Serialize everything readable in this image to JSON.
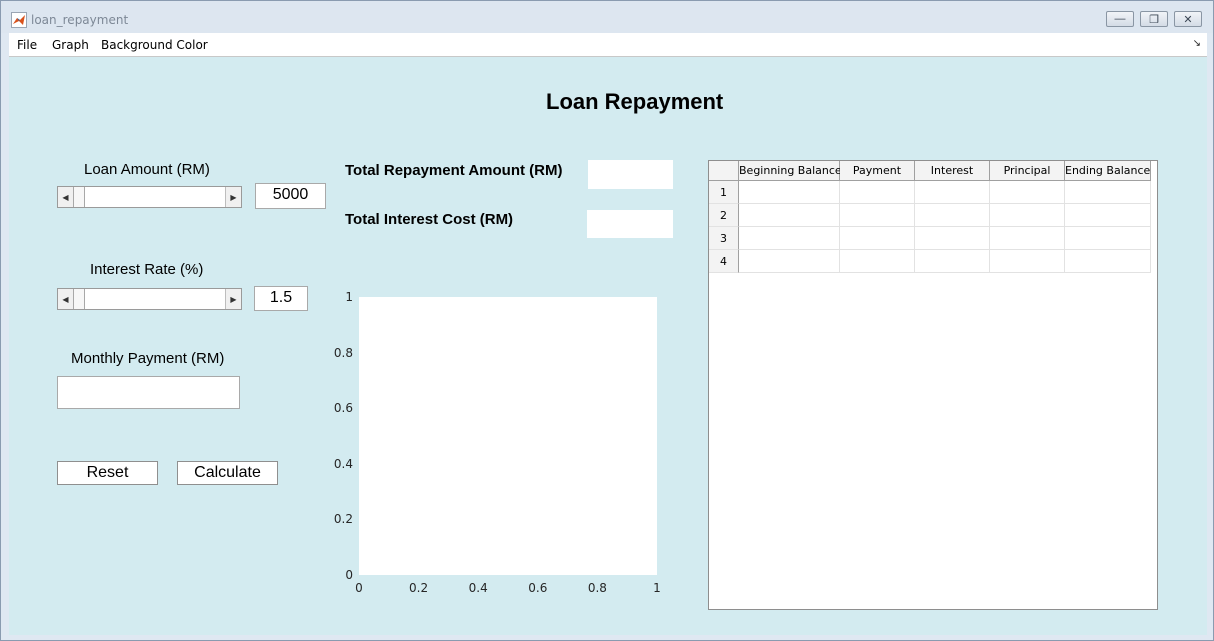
{
  "window": {
    "title": "loan_repayment"
  },
  "menubar": {
    "items": [
      "File",
      "Graph",
      "Background Color"
    ]
  },
  "heading": "Loan Repayment",
  "loan_amount": {
    "label": "Loan Amount (RM)",
    "value": "5000"
  },
  "interest_rate": {
    "label": "Interest Rate (%)",
    "value": "1.5"
  },
  "monthly_payment": {
    "label": "Monthly Payment (RM)",
    "value": ""
  },
  "buttons": {
    "reset": "Reset",
    "calculate": "Calculate"
  },
  "totals": {
    "repayment_label": "Total  Repayment Amount (RM)",
    "repayment_value": "",
    "interest_label": "Total Interest Cost (RM)",
    "interest_value": ""
  },
  "chart_data": {
    "type": "line",
    "series": [],
    "xlim": [
      0,
      1
    ],
    "ylim": [
      0,
      1
    ],
    "xticks": [
      "0",
      "0.2",
      "0.4",
      "0.6",
      "0.8",
      "1"
    ],
    "yticks": [
      "0",
      "0.2",
      "0.4",
      "0.6",
      "0.8",
      "1"
    ],
    "grid": false
  },
  "table": {
    "columns": [
      "Beginning Balance",
      "Payment",
      "Interest",
      "Principal",
      "Ending Balance"
    ],
    "row_numbers": [
      "1",
      "2",
      "3",
      "4"
    ]
  },
  "colors": {
    "figure_background": "#d3ebf0"
  }
}
